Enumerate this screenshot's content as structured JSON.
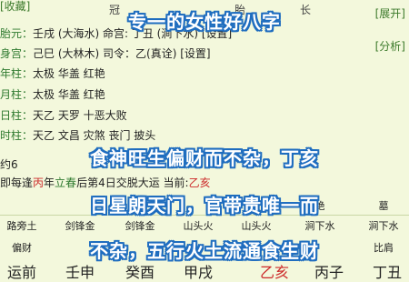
{
  "top": {
    "collect": "[收藏]",
    "expand": "[展开]",
    "analyze": "[分析]",
    "partial_a": "冠",
    "partial_b": "胎",
    "partial_c": "长"
  },
  "rows": {
    "taiyuan": {
      "label": "胎元：",
      "value": "壬戌 (大海水)  命宫: 丁丑 (涧下水) [设置]"
    },
    "shengong": {
      "label": "身宫：",
      "value": "己巳 (大林木)  司令：",
      "extra": "乙(真诠) [设置]"
    },
    "nianzhu": {
      "label": "年柱：",
      "value": "太极 华盖 红艳"
    },
    "yuezhu": {
      "label": "月柱：",
      "value": "太极 华盖 红艳"
    },
    "rizhu": {
      "label": "日柱：",
      "value": "天乙 天罗 十恶大败"
    },
    "shizhu": {
      "label": "时柱：",
      "value": "天乙 文昌 灾煞 丧门 披头"
    }
  },
  "overlay": {
    "line1": "专一的女性好八字",
    "line2": "食神旺生偏财而不杂，丁亥",
    "line3": "日星朗天门，官带贵唯一而",
    "line4": "不杂，五行火土流通食生财"
  },
  "info": {
    "partial_line": "约6",
    "jiaoyun_prefix": "即每逢",
    "bing": "丙",
    "year_text": "年",
    "lichun": "立春",
    "after_lichun": "后第",
    "day": "4",
    "after_day": "日交脱大运 当前:",
    "current": "乙亥"
  },
  "grid": {
    "row_terms": [
      "路旁土",
      "剑锋金",
      "剑锋金",
      "山头火",
      "山头火",
      "涧下水",
      "涧下水"
    ],
    "row_partial": [
      "偏财",
      "",
      "",
      "",
      "",
      "",
      "比肩"
    ],
    "row_top": [
      "",
      "",
      "",
      "",
      "",
      "绝",
      "墓"
    ],
    "bottom": [
      "运前",
      "壬申",
      "癸酉",
      "甲戌",
      "乙亥",
      "丙子",
      "丁丑"
    ]
  },
  "colors": {
    "accent": "#3c7a2b",
    "red": "#cc2a2a",
    "overlay_outline": "#1f6dbf",
    "background": "#f3f8dc"
  }
}
